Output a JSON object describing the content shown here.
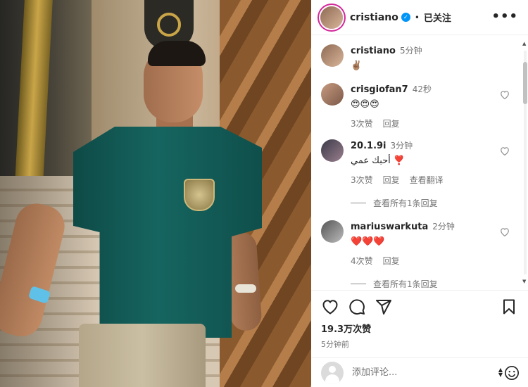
{
  "post": {
    "username": "cristiano",
    "follow_status": "已关注",
    "more_label": "•••"
  },
  "caption": {
    "username": "cristiano",
    "time": "5分钟",
    "text": "✌🏽"
  },
  "comments": [
    {
      "username": "crisgiofan7",
      "time": "42秒",
      "text": "😍😍😍",
      "likes": "3次赞",
      "reply": "回复",
      "translate": ""
    },
    {
      "username": "20.1.9i",
      "time": "3分钟",
      "text": "أحبك عمي ❣️",
      "likes": "3次赞",
      "reply": "回复",
      "translate": "查看翻译",
      "view_replies": "查看所有1条回复"
    },
    {
      "username": "mariuswarkuta",
      "time": "2分钟",
      "text": "❤️❤️❤️",
      "likes": "4次赞",
      "reply": "回复",
      "translate": "",
      "view_replies": "查看所有1条回复"
    }
  ],
  "stats": {
    "likes": "19.3万次赞",
    "posted": "5分钟前"
  },
  "add_comment": {
    "placeholder": "添加评论..."
  },
  "icons": {
    "like": "heart-icon",
    "comment": "comment-icon",
    "share": "share-icon",
    "save": "bookmark-icon",
    "emoji": "emoji-icon",
    "verified": "verified-badge-icon"
  },
  "colors": {
    "verified": "#0095f6",
    "story_ring": "#d3289b",
    "muted_text": "#737373"
  }
}
